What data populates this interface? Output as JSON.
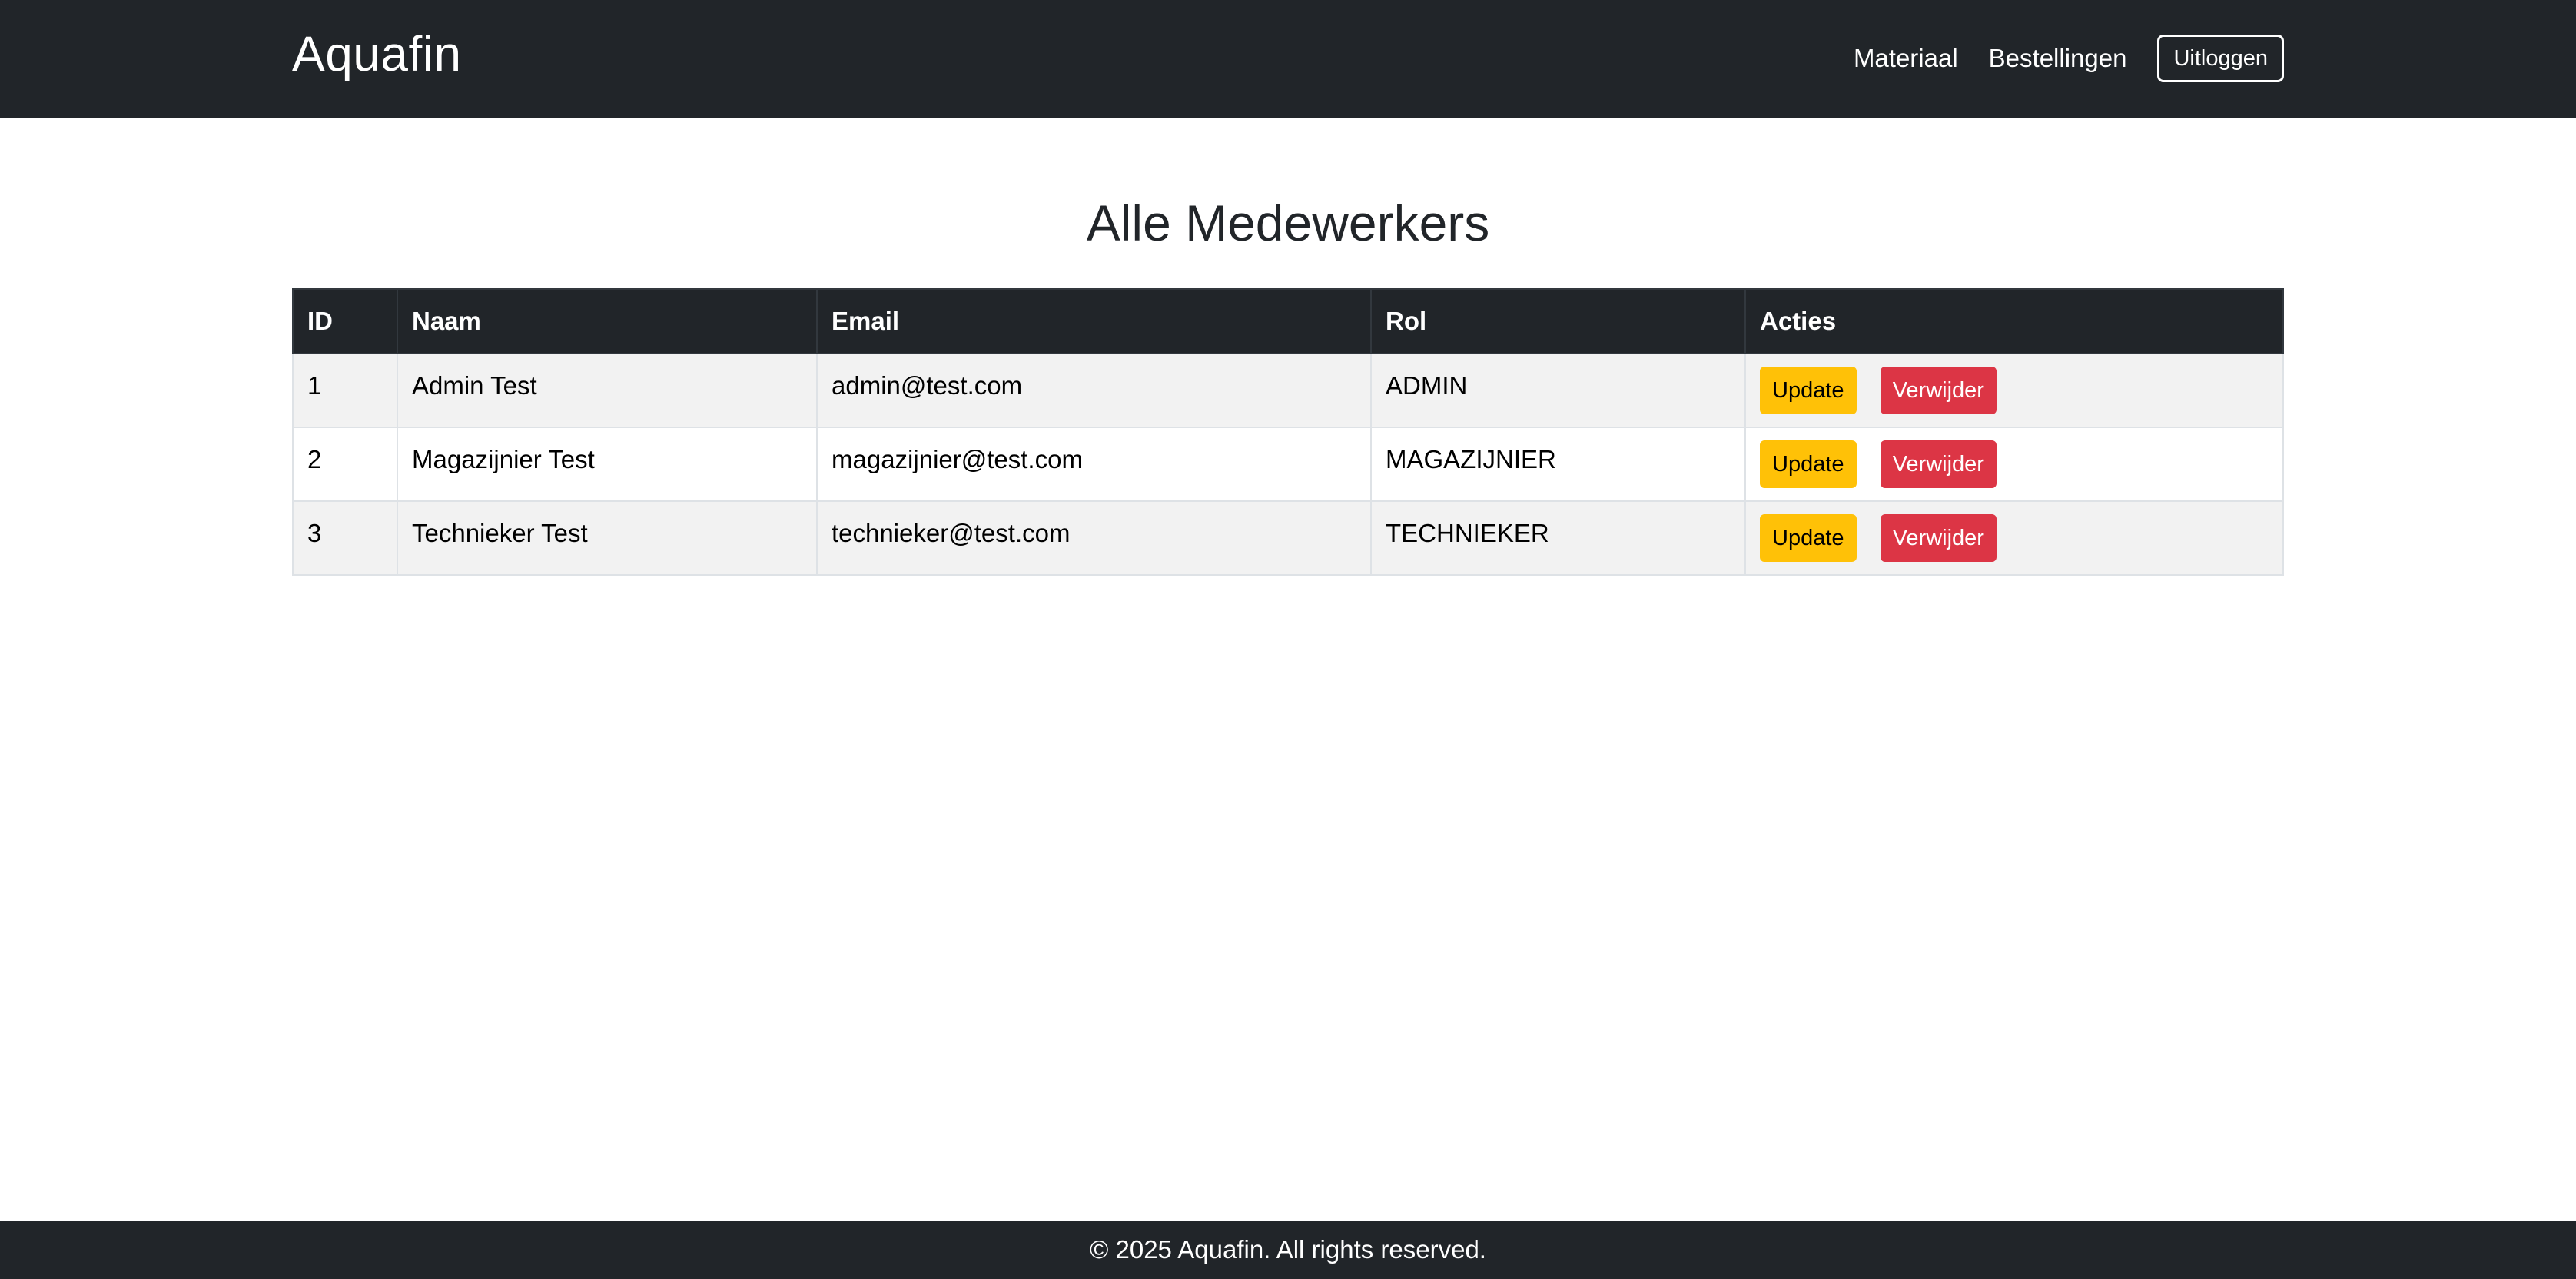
{
  "header": {
    "brand": "Aquafin",
    "nav": {
      "materiaal": "Materiaal",
      "bestellingen": "Bestellingen",
      "logout": "Uitloggen"
    }
  },
  "main": {
    "title": "Alle Medewerkers",
    "table": {
      "columns": [
        "ID",
        "Naam",
        "Email",
        "Rol",
        "Acties"
      ],
      "rows": [
        {
          "id": "1",
          "naam": "Admin Test",
          "email": "admin@test.com",
          "rol": "ADMIN"
        },
        {
          "id": "2",
          "naam": "Magazijnier Test",
          "email": "magazijnier@test.com",
          "rol": "MAGAZIJNIER"
        },
        {
          "id": "3",
          "naam": "Technieker Test",
          "email": "technieker@test.com",
          "rol": "TECHNIEKER"
        }
      ],
      "actions": {
        "update_label": "Update",
        "delete_label": "Verwijder"
      }
    }
  },
  "footer": {
    "text": "© 2025 Aquafin. All rights reserved."
  },
  "colors": {
    "navbar_bg": "#212529",
    "update_btn": "#ffc107",
    "delete_btn": "#dc3545",
    "stripe": "#f2f2f2"
  }
}
